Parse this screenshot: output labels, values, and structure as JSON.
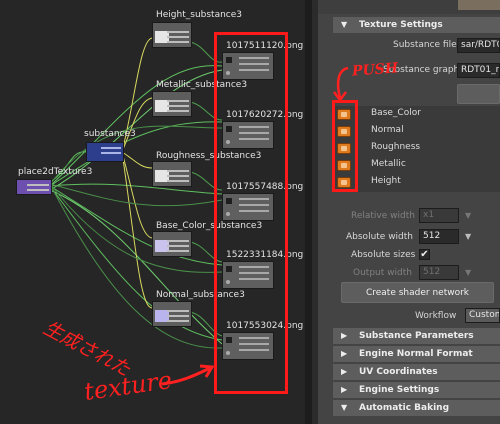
{
  "nodes": {
    "place2d": "place2dTexture3",
    "substance": "substance3",
    "height": "Height_substance3",
    "metallic": "Metallic_substance3",
    "roughness": "Roughness_substance3",
    "base_color": "Base_Color_substance3",
    "normal": "Normal_substance3"
  },
  "files": [
    "1017511120.png",
    "1017620272.png",
    "1017557488.png",
    "1522331184.png",
    "1017553024.png"
  ],
  "annotations": {
    "push": "PUSH",
    "generated_jp": "生成された",
    "texture": "texture"
  },
  "panel": {
    "texture_settings": "Texture Settings",
    "substance_file_label": "Substance file",
    "substance_file_value": "sar/RDT0",
    "substance_graph_label": "Substance graph",
    "substance_graph_value": "RDT01_r",
    "outputs": [
      "Base_Color",
      "Normal",
      "Roughness",
      "Metallic",
      "Height"
    ],
    "relative_width_label": "Relative width",
    "relative_width_value": "x1",
    "absolute_width_label": "Absolute width",
    "absolute_width_value": "512",
    "absolute_sizes_label": "Absolute sizes",
    "absolute_sizes_check": "✔",
    "output_width_label": "Output width",
    "output_width_value": "512",
    "create_shader_button": "Create shader network",
    "workflow_label": "Workflow",
    "workflow_value": "Custom",
    "sections": [
      "Substance Parameters",
      "Engine Normal Format",
      "UV Coordinates",
      "Engine Settings",
      "Automatic Baking"
    ]
  }
}
